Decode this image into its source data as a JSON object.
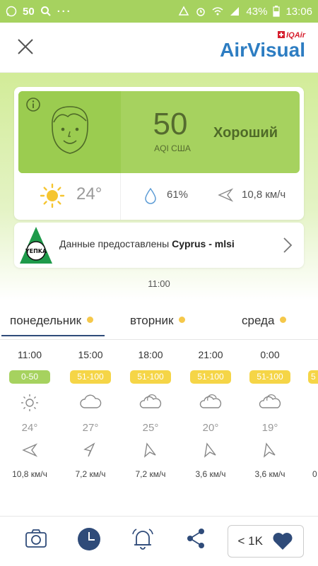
{
  "status_bar": {
    "notification_count": "50",
    "dots": "···",
    "battery": "43%",
    "time": "13:06"
  },
  "header": {
    "brand_small": "IQAir",
    "brand_big": "AirVisual"
  },
  "aqi_card": {
    "value": "50",
    "label": "AQI США",
    "status": "Хороший",
    "temperature": "24°",
    "humidity": "61%",
    "wind": "10,8 км/ч"
  },
  "source": {
    "logo_text": "ΥΕΠΚΑ",
    "prefix": "Данные предоставлены ",
    "name": "Cyprus - mlsi"
  },
  "updated_time": "11:00",
  "tabs": [
    {
      "label": "понедельник"
    },
    {
      "label": "вторник"
    },
    {
      "label": "среда"
    }
  ],
  "hourly": [
    {
      "time": "11:00",
      "aqi": "0-50",
      "temp": "24°",
      "wind": "10,8 км/ч",
      "icon": "sun",
      "badge_color": "#a6d25f"
    },
    {
      "time": "15:00",
      "aqi": "51-100",
      "temp": "27°",
      "wind": "7,2 км/ч",
      "icon": "cloud",
      "badge_color": "#f5d547"
    },
    {
      "time": "18:00",
      "aqi": "51-100",
      "temp": "25°",
      "wind": "7,2 км/ч",
      "icon": "cloud",
      "badge_color": "#f5d547"
    },
    {
      "time": "21:00",
      "aqi": "51-100",
      "temp": "20°",
      "wind": "3,6 км/ч",
      "icon": "cloud",
      "badge_color": "#f5d547"
    },
    {
      "time": "0:00",
      "aqi": "51-100",
      "temp": "19°",
      "wind": "3,6 км/ч",
      "icon": "cloud",
      "badge_color": "#f5d547"
    },
    {
      "time": "",
      "aqi": "5",
      "temp": "",
      "wind": "0",
      "icon": "none",
      "badge_color": "#f5d547"
    }
  ],
  "bottom_nav": {
    "likes": "< 1K"
  },
  "colors": {
    "aqi_good": "#a6d25f",
    "aqi_moderate": "#f5d547",
    "brand_blue": "#2d7dc2",
    "nav_dark": "#2f4b79"
  }
}
